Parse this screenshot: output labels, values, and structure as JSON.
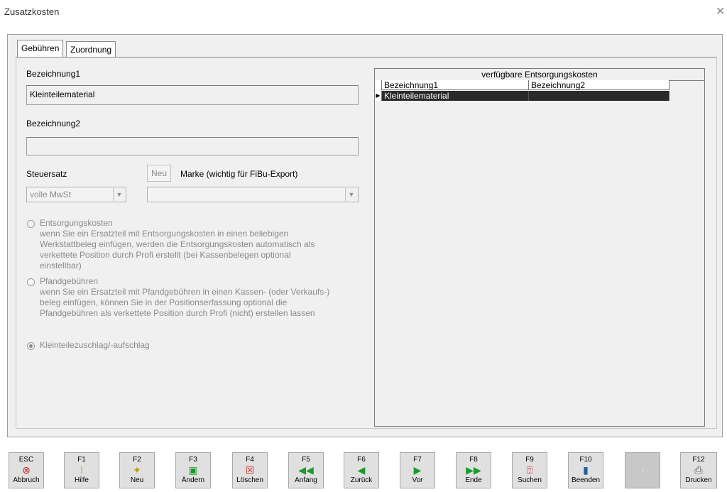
{
  "window": {
    "title": "Zusatzkosten"
  },
  "tabs": [
    {
      "label": "Gebühren"
    },
    {
      "label": "Zuordnung"
    }
  ],
  "form": {
    "bezeichnung1_label": "Bezeichnung1",
    "bezeichnung1_value": "Kleinteilematerial",
    "bezeichnung2_label": "Bezeichnung2",
    "bezeichnung2_value": "",
    "steuersatz_label": "Steuersatz",
    "steuersatz_value": "volle MwSt",
    "neu_button": "Neu",
    "marke_label": "Marke (wichtig für FiBu-Export)",
    "marke_value": ""
  },
  "options": [
    {
      "title": "Entsorgungskosten",
      "lines": [
        "wenn Sie ein Ersatzteil mit Entsorgungskosten in einen beliebigen",
        "Werkstattbeleg einfügen, werden die Entsorgungskosten automatisch als",
        "verkettete Position durch Profi erstellt (bei Kassenbelegen optional",
        "einstellbar)"
      ],
      "selected": false
    },
    {
      "title": "Pfandgebühren",
      "lines": [
        "wenn Sie ein Ersatzteil mit Pfandgebühren in einen Kassen- (oder Verkaufs-)",
        "beleg einfügen, können Sie in der Positionserfassung optional die",
        "Pfandgebühren als verkettete Position durch Profi (nicht) erstellen lassen"
      ],
      "selected": false
    },
    {
      "title": "Kleinteilezuschlag/-aufschlag",
      "lines": [],
      "selected": true
    }
  ],
  "grid": {
    "caption": "verfügbare Entsorgungskosten",
    "columns": [
      "Bezeichnung1",
      "Bezeichnung2"
    ],
    "rows": [
      [
        "Kleinteilematerial",
        ""
      ]
    ]
  },
  "fkeys": [
    {
      "key": "ESC",
      "label": "Abbruch",
      "icon": "cancel-icon"
    },
    {
      "key": "F1",
      "label": "Hilfe",
      "icon": "help-icon"
    },
    {
      "key": "F2",
      "label": "Neu",
      "icon": "new-icon"
    },
    {
      "key": "F3",
      "label": "Ändern",
      "icon": "edit-icon"
    },
    {
      "key": "F4",
      "label": "Löschen",
      "icon": "delete-icon"
    },
    {
      "key": "F5",
      "label": "Anfang",
      "icon": "first-icon"
    },
    {
      "key": "F6",
      "label": "Zurück",
      "icon": "previous-icon"
    },
    {
      "key": "F7",
      "label": "Vor",
      "icon": "next-icon"
    },
    {
      "key": "F8",
      "label": "Ende",
      "icon": "last-icon"
    },
    {
      "key": "F9",
      "label": "Suchen",
      "icon": "search-icon"
    },
    {
      "key": "F10",
      "label": "Beenden",
      "icon": "exit-icon"
    },
    {
      "key": "",
      "label": "",
      "icon": "empty-icon"
    },
    {
      "key": "F12",
      "label": "Drucken",
      "icon": "print-icon"
    }
  ],
  "colors": {
    "green": "#1a9a2a",
    "selection": "#2a2a2a"
  }
}
